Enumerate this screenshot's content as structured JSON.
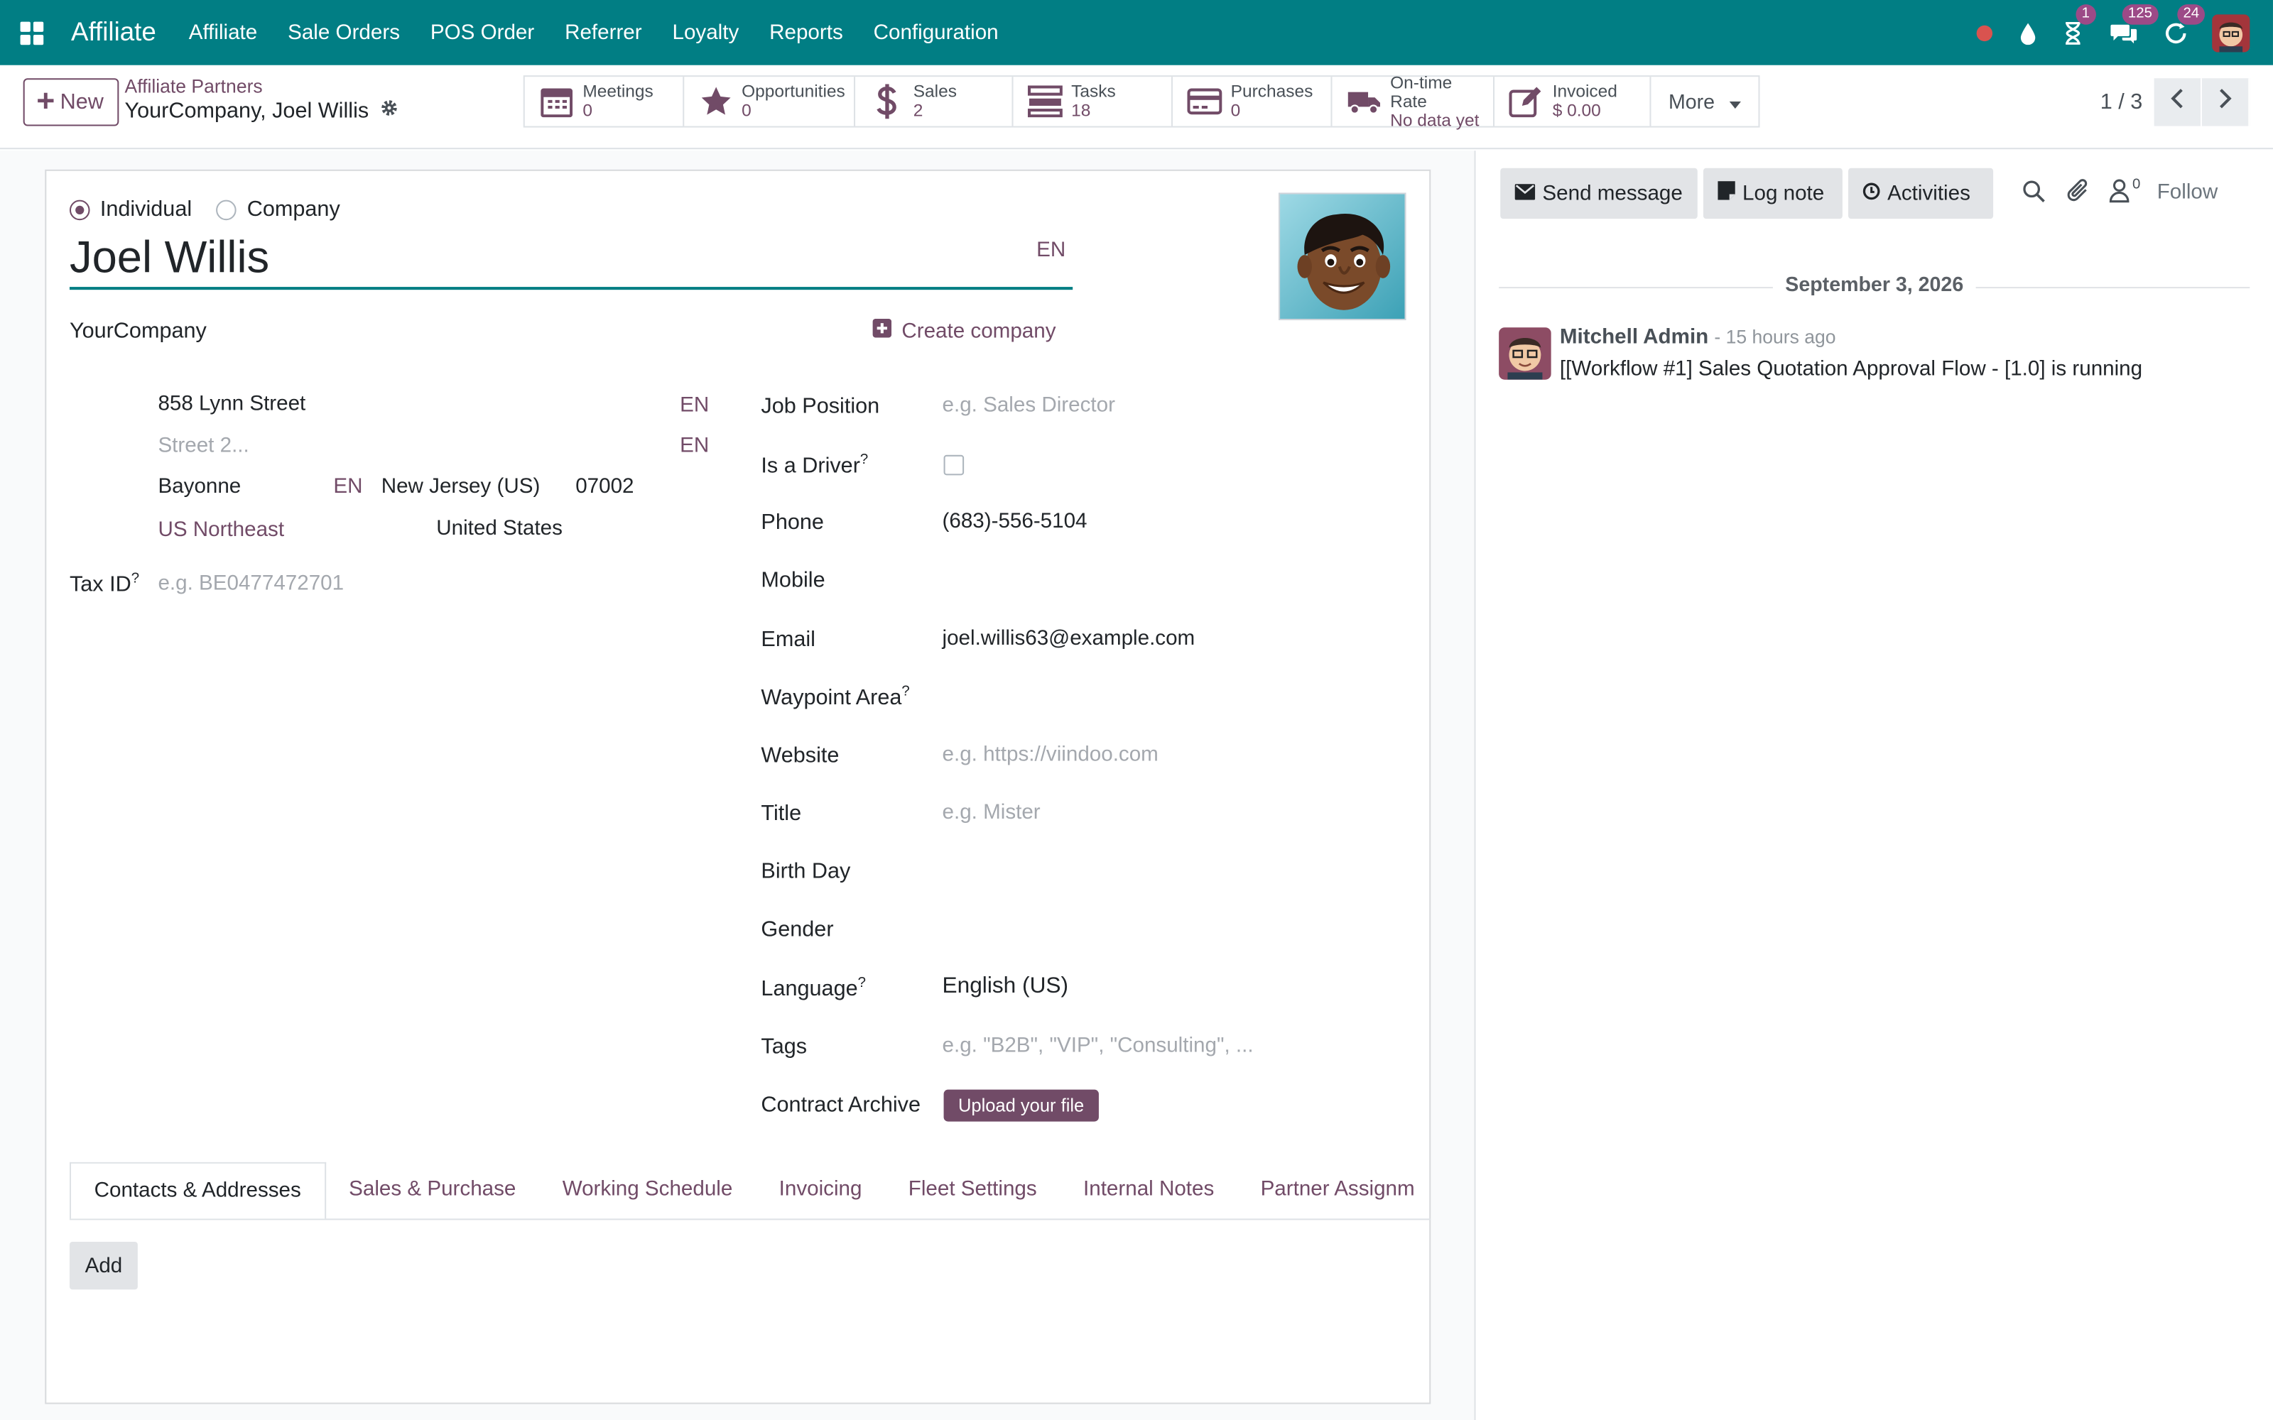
{
  "navbar": {
    "brand": "Affiliate",
    "menu": [
      "Affiliate",
      "Sale Orders",
      "POS Order",
      "Referrer",
      "Loyalty",
      "Reports",
      "Configuration"
    ],
    "badges": {
      "activities": "1",
      "messages": "125",
      "updates": "24"
    },
    "colors": {
      "navbar_bg": "#017e84",
      "accent": "#714b67",
      "badge": "#9c4a87"
    }
  },
  "control_panel": {
    "new_label": "New",
    "breadcrumb_parent": "Affiliate Partners",
    "breadcrumb_current": "YourCompany, Joel Willis",
    "smart_buttons": [
      {
        "label": "Meetings",
        "value": "0",
        "icon": "calendar-icon"
      },
      {
        "label": "Opportunities",
        "value": "0",
        "icon": "star-icon"
      },
      {
        "label": "Sales",
        "value": "2",
        "icon": "dollar-icon"
      },
      {
        "label": "Tasks",
        "value": "18",
        "icon": "tasks-icon"
      },
      {
        "label": "Purchases",
        "value": "0",
        "icon": "credit-card-icon"
      },
      {
        "label": "On-time Rate",
        "value": "No data yet",
        "icon": "truck-icon"
      },
      {
        "label": "Invoiced",
        "value": "$ 0.00",
        "icon": "pencil-square-icon"
      }
    ],
    "more_label": "More",
    "pager": "1 / 3"
  },
  "form": {
    "type_individual": "Individual",
    "type_company": "Company",
    "name": "Joel Willis",
    "lang_tag": "EN",
    "company": "YourCompany",
    "create_company": "Create company",
    "address": {
      "street": "858 Lynn Street",
      "street2_placeholder": "Street 2...",
      "city": "Bayonne",
      "state": "New Jersey (US)",
      "zip": "07002",
      "region": "US Northeast",
      "country": "United States"
    },
    "tax_id_label": "Tax ID",
    "tax_id_placeholder": "e.g. BE0477472701",
    "fields": {
      "job_position_label": "Job Position",
      "job_position_placeholder": "e.g. Sales Director",
      "is_driver_label": "Is a Driver",
      "phone_label": "Phone",
      "phone": "(683)-556-5104",
      "mobile_label": "Mobile",
      "email_label": "Email",
      "email": "joel.willis63@example.com",
      "waypoint_label": "Waypoint Area",
      "website_label": "Website",
      "website_placeholder": "e.g. https://viindoo.com",
      "title_label": "Title",
      "title_placeholder": "e.g. Mister",
      "birthday_label": "Birth Day",
      "gender_label": "Gender",
      "language_label": "Language",
      "language": "English (US)",
      "tags_label": "Tags",
      "tags_placeholder": "e.g. \"B2B\", \"VIP\", \"Consulting\", ...",
      "contract_label": "Contract Archive",
      "upload_label": "Upload your file"
    },
    "tabs": [
      "Contacts & Addresses",
      "Sales & Purchase",
      "Working Schedule",
      "Invoicing",
      "Fleet Settings",
      "Internal Notes",
      "Partner Assignm"
    ],
    "add_label": "Add"
  },
  "chatter": {
    "send_message": "Send message",
    "log_note": "Log note",
    "activities": "Activities",
    "followers_count": "0",
    "follow": "Follow",
    "date": "September 3, 2026",
    "message": {
      "author": "Mitchell Admin",
      "time": "- 15 hours ago",
      "body": "[[Workflow #1] Sales Quotation Approval Flow - [1.0] is running"
    }
  }
}
